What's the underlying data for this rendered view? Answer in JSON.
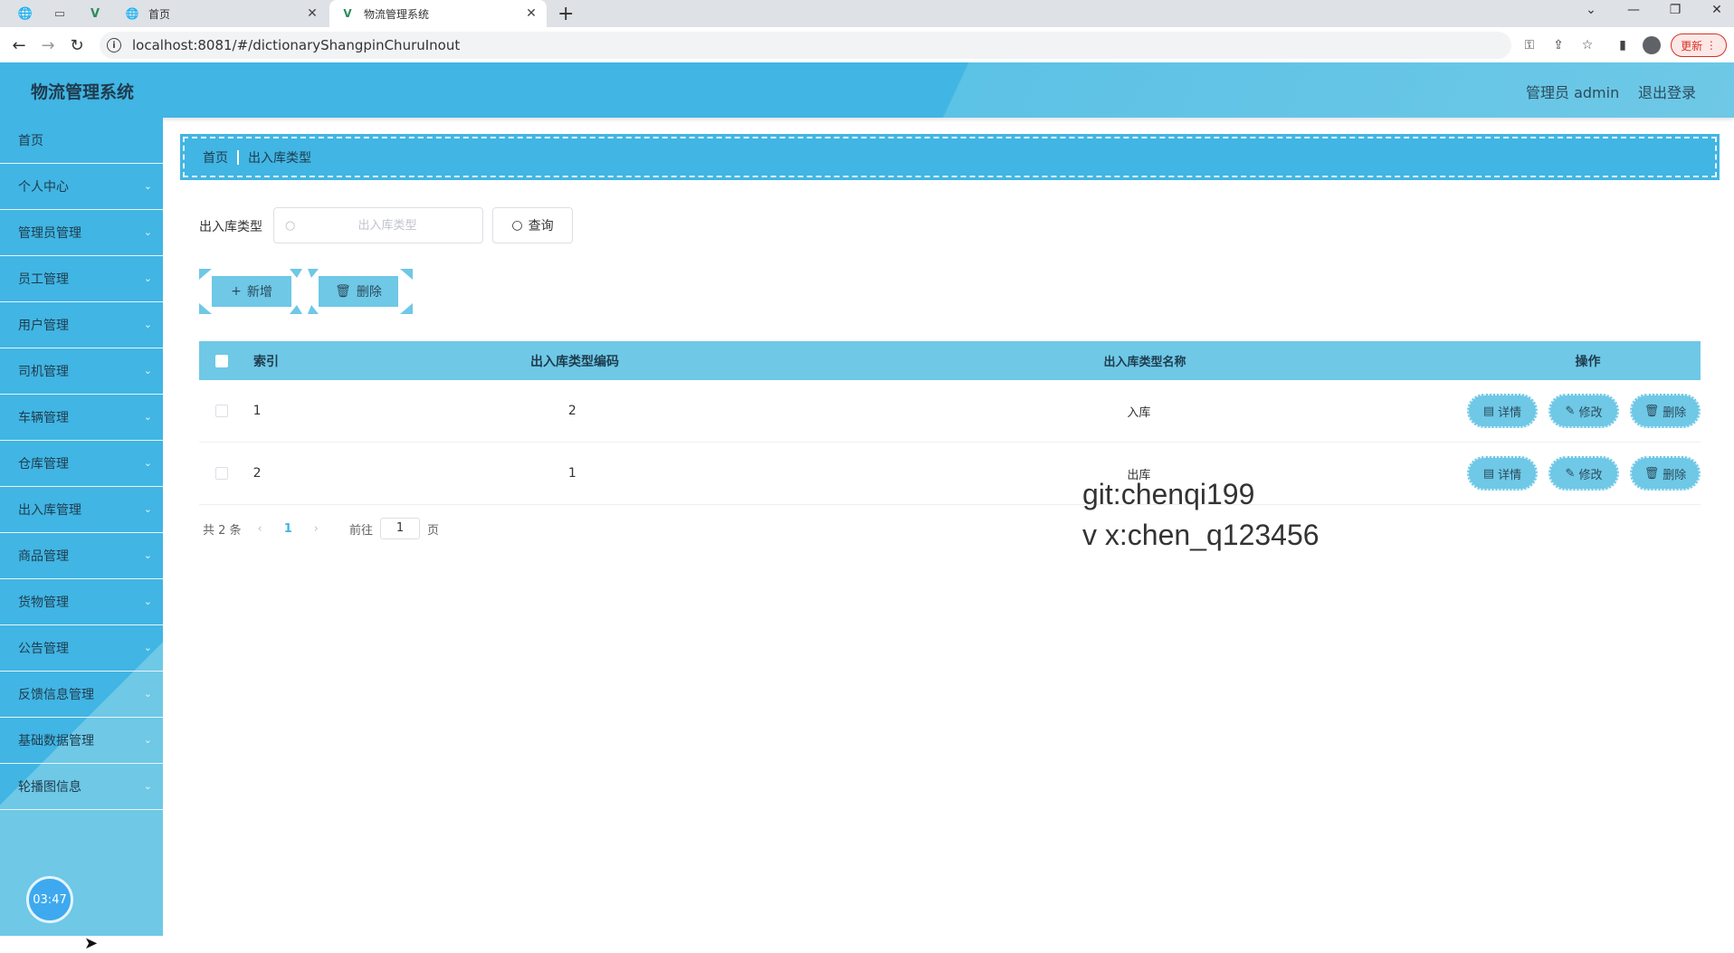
{
  "browser": {
    "tabs": [
      {
        "title": "首页"
      },
      {
        "title": "物流管理系统"
      }
    ],
    "url": "localhost:8081/#/dictionaryShangpinChuruInout",
    "update_label": "更新"
  },
  "header": {
    "title": "物流管理系统",
    "user": "管理员 admin",
    "logout": "退出登录"
  },
  "sidebar": {
    "items": [
      {
        "label": "首页"
      },
      {
        "label": "个人中心"
      },
      {
        "label": "管理员管理"
      },
      {
        "label": "员工管理"
      },
      {
        "label": "用户管理"
      },
      {
        "label": "司机管理"
      },
      {
        "label": "车辆管理"
      },
      {
        "label": "仓库管理"
      },
      {
        "label": "出入库管理"
      },
      {
        "label": "商品管理"
      },
      {
        "label": "货物管理"
      },
      {
        "label": "公告管理"
      },
      {
        "label": "反馈信息管理"
      },
      {
        "label": "基础数据管理"
      },
      {
        "label": "轮播图信息"
      }
    ],
    "clock": "03:47"
  },
  "breadcrumb": {
    "home": "首页",
    "current": "出入库类型"
  },
  "search": {
    "label": "出入库类型",
    "placeholder": "出入库类型",
    "value": "",
    "button": "查询"
  },
  "actions": {
    "add": "新增",
    "delete": "删除"
  },
  "table": {
    "headers": {
      "index": "索引",
      "code": "出入库类型编码",
      "name": "出入库类型名称",
      "ops": "操作"
    },
    "rows": [
      {
        "index": "1",
        "code": "2",
        "name": "入库"
      },
      {
        "index": "2",
        "code": "1",
        "name": "出库"
      }
    ],
    "row_actions": {
      "detail": "详情",
      "edit": "修改",
      "delete": "删除"
    }
  },
  "pagination": {
    "total": "共 2 条",
    "current": "1",
    "goto_prefix": "前往",
    "goto_value": "1",
    "goto_suffix": "页"
  },
  "watermark": {
    "line1": "git:chenqi199",
    "line2": "v x:chen_q123456"
  },
  "colors": {
    "primary": "#41b5e3",
    "secondary": "#6ec8e6"
  }
}
